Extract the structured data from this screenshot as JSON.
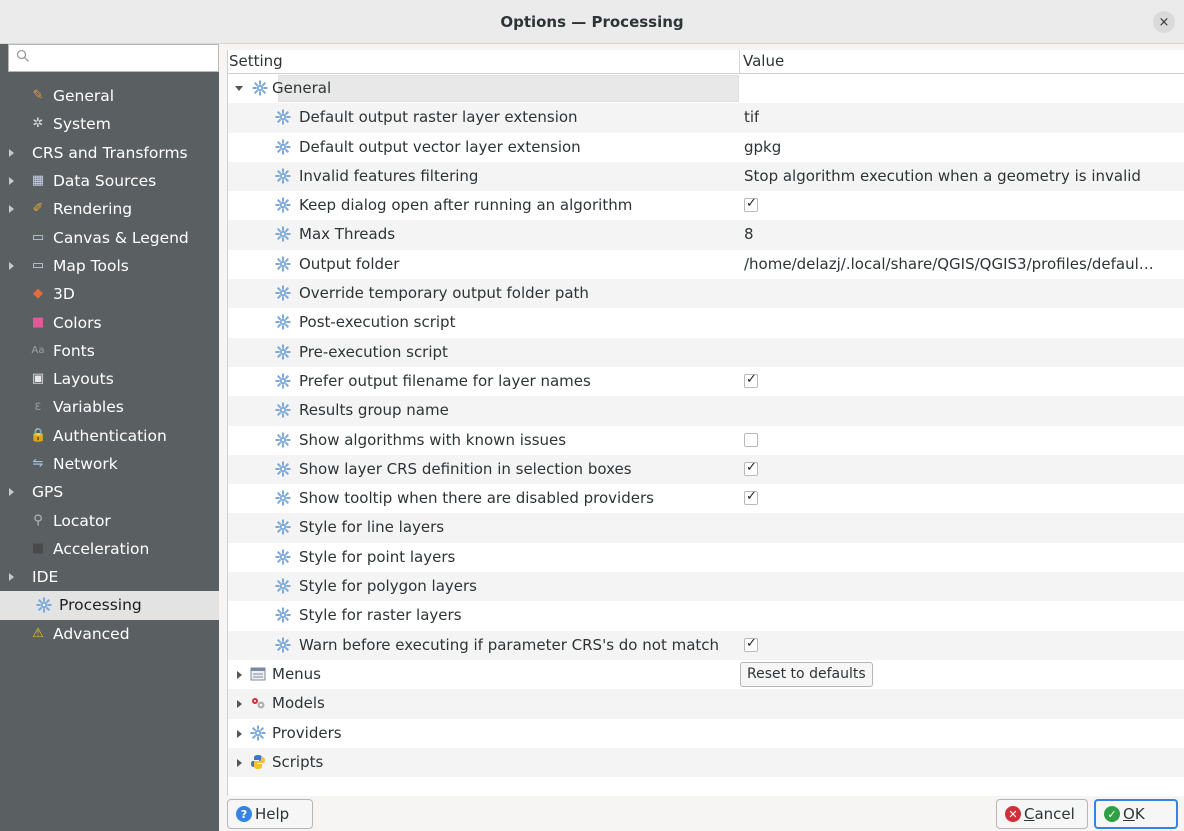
{
  "window": {
    "title": "Options — Processing",
    "close_glyph": "×"
  },
  "sidebar": {
    "search_placeholder": "",
    "items": [
      {
        "label": "General",
        "icon": "ruler-pencil-icon",
        "glyph": "✎",
        "color": "#e0a030",
        "arrow": false
      },
      {
        "label": "System",
        "icon": "system-icon",
        "glyph": "✲",
        "color": "#dddddd",
        "arrow": false
      },
      {
        "label": "CRS and Transforms",
        "icon": "",
        "glyph": "",
        "color": "",
        "arrow": true
      },
      {
        "label": "Data Sources",
        "icon": "table-icon",
        "glyph": "▦",
        "color": "#c8d4e8",
        "arrow": true
      },
      {
        "label": "Rendering",
        "icon": "brush-icon",
        "glyph": "✐",
        "color": "#e8a830",
        "arrow": true
      },
      {
        "label": "Canvas & Legend",
        "icon": "map-canvas-icon",
        "glyph": "▭",
        "color": "#c8d4e8",
        "arrow": false
      },
      {
        "label": "Map Tools",
        "icon": "map-tools-icon",
        "glyph": "▭",
        "color": "#c8d4e8",
        "arrow": true
      },
      {
        "label": "3D",
        "icon": "cube-3d-icon",
        "glyph": "◆",
        "color": "#e86a3a",
        "arrow": false
      },
      {
        "label": "Colors",
        "icon": "palette-icon",
        "glyph": "■",
        "color": "#e05a9a",
        "arrow": false
      },
      {
        "label": "Fonts",
        "icon": "font-icon",
        "glyph": "Aa",
        "color": "#a0a0a0",
        "arrow": false
      },
      {
        "label": "Layouts",
        "icon": "layout-icon",
        "glyph": "▣",
        "color": "#e8e8e8",
        "arrow": false
      },
      {
        "label": "Variables",
        "icon": "variables-icon",
        "glyph": "ε",
        "color": "#9a9a9a",
        "arrow": false
      },
      {
        "label": "Authentication",
        "icon": "lock-icon",
        "glyph": "🔒",
        "color": "#f0c020",
        "arrow": false
      },
      {
        "label": "Network",
        "icon": "network-icon",
        "glyph": "⇋",
        "color": "#a8c8e8",
        "arrow": false
      },
      {
        "label": "GPS",
        "icon": "",
        "glyph": "",
        "color": "",
        "arrow": true
      },
      {
        "label": "Locator",
        "icon": "search-icon",
        "glyph": "⚲",
        "color": "#bbbbbb",
        "arrow": false
      },
      {
        "label": "Acceleration",
        "icon": "chip-icon",
        "glyph": "■",
        "color": "#4a4a4a",
        "arrow": false
      },
      {
        "label": "IDE",
        "icon": "",
        "glyph": "",
        "color": "",
        "arrow": true
      },
      {
        "label": "Processing",
        "icon": "gear-icon",
        "glyph": "",
        "color": "#7aa8d8",
        "arrow": false,
        "selected": true
      },
      {
        "label": "Advanced",
        "icon": "warning-icon",
        "glyph": "⚠",
        "color": "#f0c020",
        "arrow": false
      }
    ]
  },
  "tree": {
    "header": {
      "setting": "Setting",
      "value": "Value"
    },
    "group_general": "General",
    "rows": [
      {
        "label": "Default output raster layer extension",
        "type": "text",
        "value": "tif"
      },
      {
        "label": "Default output vector layer extension",
        "type": "text",
        "value": "gpkg"
      },
      {
        "label": "Invalid features filtering",
        "type": "text",
        "value": "Stop algorithm execution when a geometry is invalid"
      },
      {
        "label": "Keep dialog open after running an algorithm",
        "type": "check",
        "checked": true
      },
      {
        "label": "Max Threads",
        "type": "text",
        "value": "8"
      },
      {
        "label": "Output folder",
        "type": "text",
        "value": "/home/delazj/.local/share/QGIS/QGIS3/profiles/defaul…"
      },
      {
        "label": "Override temporary output folder path",
        "type": "text",
        "value": ""
      },
      {
        "label": "Post-execution script",
        "type": "text",
        "value": ""
      },
      {
        "label": "Pre-execution script",
        "type": "text",
        "value": ""
      },
      {
        "label": "Prefer output filename for layer names",
        "type": "check",
        "checked": true
      },
      {
        "label": "Results group name",
        "type": "text",
        "value": ""
      },
      {
        "label": "Show algorithms with known issues",
        "type": "check",
        "checked": false
      },
      {
        "label": "Show layer CRS definition in selection boxes",
        "type": "check",
        "checked": true
      },
      {
        "label": "Show tooltip when there are disabled providers",
        "type": "check",
        "checked": true
      },
      {
        "label": "Style for line layers",
        "type": "text",
        "value": ""
      },
      {
        "label": "Style for point layers",
        "type": "text",
        "value": ""
      },
      {
        "label": "Style for polygon layers",
        "type": "text",
        "value": ""
      },
      {
        "label": "Style for raster layers",
        "type": "text",
        "value": ""
      },
      {
        "label": "Warn before executing if parameter CRS's do not match",
        "type": "check",
        "checked": true
      }
    ],
    "groups": [
      {
        "label": "Menus",
        "icon": "menu-icon",
        "button": "Reset to defaults"
      },
      {
        "label": "Models",
        "icon": "models-icon",
        "button": ""
      },
      {
        "label": "Providers",
        "icon": "gear-icon",
        "button": ""
      },
      {
        "label": "Scripts",
        "icon": "python-icon",
        "button": ""
      }
    ],
    "check_glyph": "✓"
  },
  "buttons": {
    "help": "Help",
    "cancel_first": "C",
    "cancel_rest": "ancel",
    "ok_first": "O",
    "ok_rest": "K"
  },
  "colors": {
    "sidebar_bg": "#5a5f61",
    "selected_bg": "#e3e3e3",
    "gear": "#7aa8d8"
  }
}
